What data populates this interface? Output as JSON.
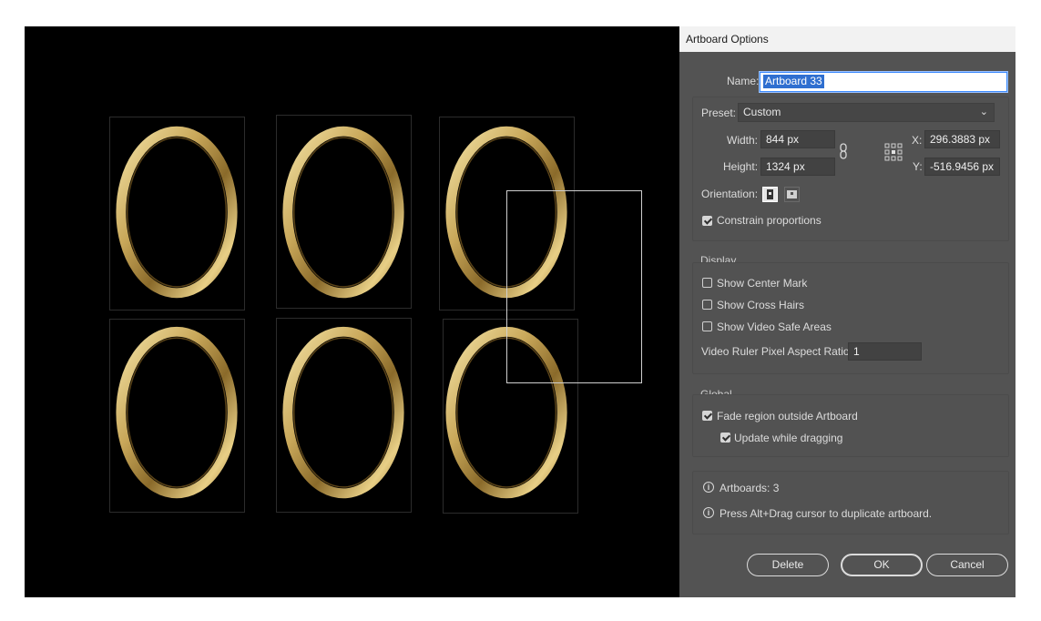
{
  "dialog": {
    "title": "Artboard Options",
    "name_label": "Name:",
    "name_value": "Artboard 33",
    "preset_label": "Preset:",
    "preset_value": "Custom",
    "width_label": "Width:",
    "width_value": "844 px",
    "height_label": "Height:",
    "height_value": "1324 px",
    "x_label": "X:",
    "x_value": "296.3883 px",
    "y_label": "Y:",
    "y_value": "-516.9456 px",
    "orientation_label": "Orientation:",
    "constrain_label": "Constrain proportions",
    "constrain_checked": true
  },
  "display": {
    "heading": "Display",
    "show_center_mark": "Show Center Mark",
    "show_cross_hairs": "Show Cross Hairs",
    "show_video_safe": "Show Video Safe Areas",
    "ratio_label": "Video Ruler Pixel Aspect Ratio:",
    "ratio_value": "1"
  },
  "global": {
    "heading": "Global",
    "fade_label": "Fade region outside Artboard",
    "fade_checked": true,
    "update_label": "Update while dragging",
    "update_checked": true
  },
  "info": {
    "artboards": "Artboards: 3",
    "tip": "Press Alt+Drag cursor to duplicate artboard."
  },
  "buttons": {
    "delete": "Delete",
    "ok": "OK",
    "cancel": "Cancel"
  },
  "canvas": {
    "background": "#000000",
    "frame_color": "#c9a85a",
    "artboard_count": 6
  }
}
